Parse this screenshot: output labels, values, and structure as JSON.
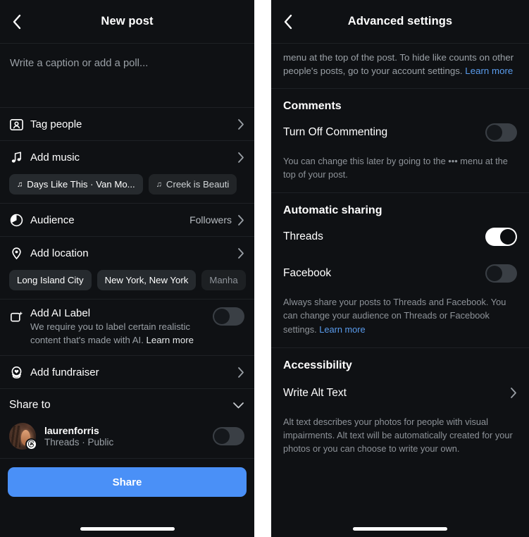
{
  "left_panel": {
    "nav": {
      "back_icon": "chevron-left-icon",
      "title": "New post"
    },
    "caption": {
      "placeholder": "Write a caption or add a poll..."
    },
    "tag_people": {
      "label": "Tag people",
      "icon": "tag-people-icon",
      "chevron": "chevron-right-icon"
    },
    "add_music": {
      "label": "Add music",
      "icon": "music-note-icon",
      "chevron": "chevron-right-icon",
      "suggestions": [
        {
          "title": "Days Like This · Van Mo...",
          "icon": "music-note-icon"
        },
        {
          "title": "Creek is Beauti",
          "icon": "music-note-icon"
        }
      ]
    },
    "audience": {
      "label": "Audience",
      "value": "Followers",
      "icon": "audience-icon",
      "chevron": "chevron-right-icon"
    },
    "add_location": {
      "label": "Add location",
      "icon": "location-pin-icon",
      "chevron": "chevron-right-icon",
      "suggestions": [
        "Long Island City",
        "New York, New York",
        "Manha"
      ]
    },
    "ai_label": {
      "title": "Add AI Label",
      "icon": "ai-sparkle-icon",
      "description": "We require you to label certain realistic content that's made with AI. ",
      "learn_more": "Learn more",
      "toggle_state": "off"
    },
    "add_fundraiser": {
      "label": "Add fundraiser",
      "icon": "fundraiser-heart-icon",
      "chevron": "chevron-right-icon"
    },
    "share_to": {
      "label": "Share to",
      "chevron": "chevron-down-icon",
      "account": {
        "avatar": "user-avatar",
        "badge_icon": "threads-logo-icon",
        "username": "laurenforris",
        "subtitle": "Threads · Public",
        "toggle_state": "off"
      }
    },
    "share_button": {
      "label": "Share"
    },
    "home_indicator": "home-indicator"
  },
  "right_panel": {
    "nav": {
      "back_icon": "chevron-left-icon",
      "title": "Advanced settings"
    },
    "intro": {
      "text": "menu at the top of the post. To hide like counts on other people's posts, go to your account settings. ",
      "learn_more": "Learn more"
    },
    "comments": {
      "section_title": "Comments",
      "option_label": "Turn Off Commenting",
      "toggle_state": "off",
      "description": "You can change this later by going to the ••• menu at the top of your post."
    },
    "automatic_sharing": {
      "section_title": "Automatic sharing",
      "options": [
        {
          "label": "Threads",
          "toggle_state": "on"
        },
        {
          "label": "Facebook",
          "toggle_state": "off"
        }
      ],
      "description": "Always share your posts to Threads and Facebook. You can change your audience on Threads or Facebook settings. ",
      "learn_more": "Learn more"
    },
    "accessibility": {
      "section_title": "Accessibility",
      "option_label": "Write Alt Text",
      "chevron": "chevron-right-icon",
      "description": "Alt text describes your photos for people with visual impairments. Alt text will be automatically created for your photos or you can choose to write your own."
    },
    "home_indicator": "home-indicator"
  },
  "colors": {
    "background": "#0f1114",
    "divider": "#1e2125",
    "accent_blue": "#4a90f7",
    "link_blue": "#5a9ced",
    "muted_text": "#9aa0a6",
    "chip_bg": "#262a2e",
    "toggle_off": "#3a3f45",
    "toggle_on": "#ffffff"
  }
}
